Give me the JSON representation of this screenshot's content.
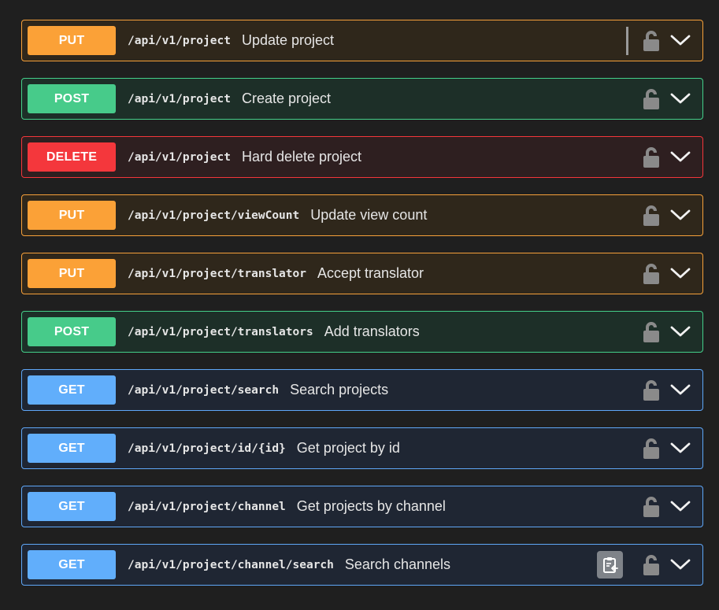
{
  "operations": [
    {
      "method": "PUT",
      "path": "/api/v1/project",
      "summary": "Update project"
    },
    {
      "method": "POST",
      "path": "/api/v1/project",
      "summary": "Create project"
    },
    {
      "method": "DELETE",
      "path": "/api/v1/project",
      "summary": "Hard delete project"
    },
    {
      "method": "PUT",
      "path": "/api/v1/project/viewCount",
      "summary": "Update view count"
    },
    {
      "method": "PUT",
      "path": "/api/v1/project/translator",
      "summary": "Accept translator"
    },
    {
      "method": "POST",
      "path": "/api/v1/project/translators",
      "summary": "Add translators"
    },
    {
      "method": "GET",
      "path": "/api/v1/project/search",
      "summary": "Search projects"
    },
    {
      "method": "GET",
      "path": "/api/v1/project/id/{id}",
      "summary": "Get project by id"
    },
    {
      "method": "GET",
      "path": "/api/v1/project/channel",
      "summary": "Get projects by channel"
    },
    {
      "method": "GET",
      "path": "/api/v1/project/channel/search",
      "summary": "Search channels"
    }
  ],
  "icons": {
    "lock": "lock-icon",
    "chevron": "chevron-down-icon",
    "copy": "copy-to-clipboard-icon"
  },
  "colors": {
    "put": "#fba137",
    "post": "#47cb8a",
    "delete": "#f4373c",
    "get": "#61aefb",
    "background": "#1f1f1f"
  }
}
